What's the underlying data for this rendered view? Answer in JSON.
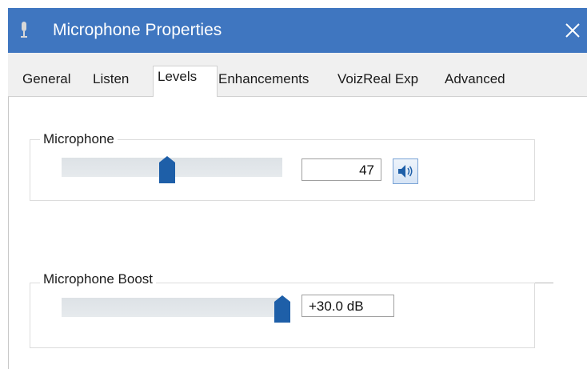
{
  "window": {
    "title": "Microphone Properties",
    "icon": "microphone-icon",
    "close_glyph": "✕",
    "titlebar_color": "#3f76c0"
  },
  "tabs": [
    {
      "label": "General"
    },
    {
      "label": "Listen"
    },
    {
      "label": "Levels",
      "active": true
    },
    {
      "label": "Enhancements"
    },
    {
      "label": "VoizReal Exp"
    },
    {
      "label": "Advanced"
    }
  ],
  "microphone": {
    "label": "Microphone",
    "value": "47",
    "slider_level_percent": 47,
    "mute_icon": "speaker-icon"
  },
  "boost": {
    "label": "Microphone Boost",
    "value": "+30.0 dB",
    "slider_level_percent": 100
  },
  "accent_color": "#1e5fa8"
}
